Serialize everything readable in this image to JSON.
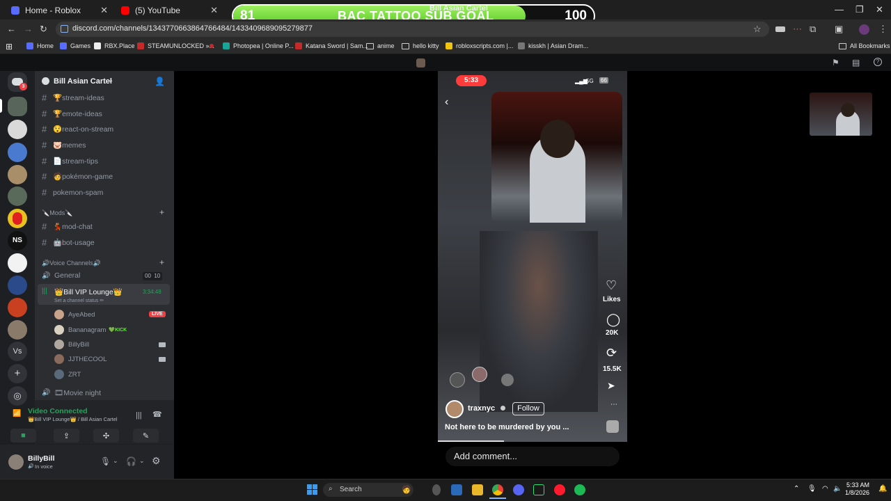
{
  "browser": {
    "tabs": [
      {
        "title": "Home - Roblox"
      },
      {
        "title": "(5) YouTube"
      }
    ],
    "url": "discord.com/channels/1343770663864766484/1433409689095279877",
    "bookmarks": [
      "Home",
      "Games",
      "RBX.Place",
      "STEAMUNLOCKED »...",
      "Photopea | Online P...",
      "Katana Sword | Sam...",
      "anime",
      "hello kitty",
      "robloxscripts.com |...",
      "kisskh | Asian Dram...",
      "All Bookmarks"
    ]
  },
  "sub_goal": {
    "title": "BAC TATTOO SUB GOAL",
    "current": "81",
    "target": "100",
    "progress": 0.81
  },
  "discord": {
    "header_title": "Bill Asian Cartel",
    "server_name": "Bill Asian Cartel",
    "rail_badge": "3",
    "rail_vs": "Vs",
    "text_channels": [
      {
        "name": "🏆stream-ideas"
      },
      {
        "name": "🏆emote-ideas"
      },
      {
        "name": "😯react-on-stream"
      },
      {
        "name": "🐷memes"
      },
      {
        "name": "📄stream-tips"
      },
      {
        "name": "🧑pokémon-game"
      },
      {
        "name": "pokemon-spam"
      }
    ],
    "mods_category": "🔪Mods🔪",
    "mod_channels": [
      {
        "name": "💃mod-chat"
      },
      {
        "name": "🤖bot-usage"
      }
    ],
    "voice_category": "🔊Voice Channels🔊",
    "general": {
      "name": "General",
      "left_count": "00",
      "right_count": "10"
    },
    "lounge": {
      "name": "👑Bill VIP Lounge👑",
      "timer": "3:34:48",
      "status": "Set a channel status ✏"
    },
    "voice_users": [
      {
        "name": "AyeAbed",
        "badge": "LIVE"
      },
      {
        "name": "Bananagram",
        "badge": "💚KICK"
      },
      {
        "name": "BillyBill",
        "badge": ""
      },
      {
        "name": "JJTHECOOL",
        "badge": ""
      },
      {
        "name": "ZRT",
        "badge": ""
      }
    ],
    "movie_night": "🎞Movie night",
    "voice_status": "Video Connected",
    "voice_location": "👑Bill VIP Lounge👑 / Bill Asian Cartel",
    "user": {
      "name": "BillyBill",
      "status": "In voice"
    }
  },
  "stream": {
    "time": "5:33",
    "signal": "5G",
    "battery": "66",
    "likes_label": "Likes",
    "comments_count": "20K",
    "shares_count": "15.5K",
    "handle": "traxnyc",
    "follow_label": "Follow",
    "caption": "Not here to be murdered by you ...",
    "comment_placeholder": "Add comment..."
  },
  "taskbar": {
    "search": "Search",
    "time": "5:33 AM",
    "date": "1/8/2026"
  }
}
